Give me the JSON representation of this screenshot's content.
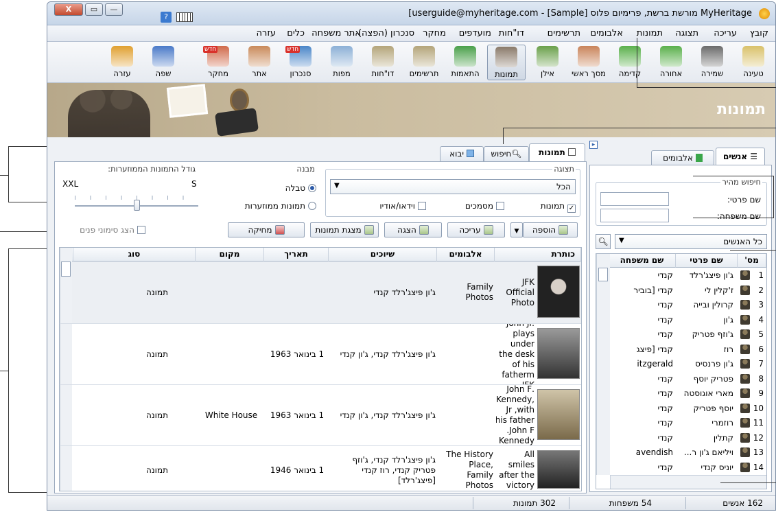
{
  "window": {
    "title": "MyHeritage מורשת ברשת, פרימיום פלוס [Sample] - userguide@myheritage.com]",
    "controls": {
      "close": "X",
      "restore": "▭",
      "minimize": "—"
    }
  },
  "menu": [
    "קובץ",
    "עריכה",
    "תצוגה",
    "תמונות",
    "אלבומים",
    "תרשימים",
    "דו\"חות",
    "מועדפים",
    "מחקר",
    "סנכרון (הפצה)",
    "אתר משפחה",
    "כלים",
    "עזרה"
  ],
  "toolbar": {
    "buttons": [
      {
        "label": "טעינה",
        "icon": "open-folder-icon"
      },
      {
        "label": "שמירה",
        "icon": "save-icon"
      },
      {
        "label": "אחורה",
        "icon": "back-arrow-icon"
      },
      {
        "label": "קדימה",
        "icon": "forward-arrow-icon"
      },
      {
        "label": "מסך ראשי",
        "icon": "home-icon"
      },
      {
        "label": "אילן",
        "icon": "tree-icon"
      },
      {
        "label": "תמונות",
        "icon": "photos-icon"
      },
      {
        "label": "התאמות",
        "icon": "matches-icon"
      },
      {
        "label": "תרשימים",
        "icon": "charts-icon"
      },
      {
        "label": "דו\"חות",
        "icon": "reports-icon"
      },
      {
        "label": "מפות",
        "icon": "maps-icon"
      },
      {
        "label": "סנכרון",
        "icon": "sync-icon",
        "badge": "חדש"
      },
      {
        "label": "אתר",
        "icon": "family-site-icon"
      },
      {
        "label": "מחקר",
        "icon": "research-icon",
        "badge": "חדש"
      },
      {
        "label": "שפה",
        "icon": "language-flag-icon"
      },
      {
        "label": "עזרה",
        "icon": "help-icon"
      }
    ]
  },
  "banner": {
    "title": "תמונות"
  },
  "left": {
    "tabs": [
      "אנשים",
      "אלבומים"
    ],
    "quick_search": {
      "legend": "חיפוש מהיר",
      "first_name": "שם פרטי:",
      "last_name": "שם משפחה:"
    },
    "filter": "כל האנשים",
    "columns": [
      "מס'",
      "שם פרטי",
      "שם משפחה"
    ],
    "people": [
      {
        "n": "1",
        "first": "ג'ון פיצג'רלד",
        "last": "קנדי"
      },
      {
        "n": "2",
        "first": "ז'קלין לי",
        "last": "קנדי [בוביר"
      },
      {
        "n": "3",
        "first": "קרולין ובייה",
        "last": "קנדי"
      },
      {
        "n": "4",
        "first": "ג'ון",
        "last": "קנדי"
      },
      {
        "n": "5",
        "first": "ג'וזף פטריק",
        "last": "קנדי"
      },
      {
        "n": "6",
        "first": "רוז",
        "last": "קנדי [פיצג"
      },
      {
        "n": "7",
        "first": "ג'ון פרנסיס",
        "last": "itzgerald"
      },
      {
        "n": "8",
        "first": "פטריק יוסף",
        "last": "קנדי"
      },
      {
        "n": "9",
        "first": "מארי אוגוסטה",
        "last": "קנדי"
      },
      {
        "n": "10",
        "first": "יוסף פטריק",
        "last": "קנדי"
      },
      {
        "n": "11",
        "first": "רוזמרי",
        "last": "קנדי"
      },
      {
        "n": "12",
        "first": "קתלין",
        "last": "קנדי"
      },
      {
        "n": "13",
        "first": "ויליאם ג'ון ר...",
        "last": "avendish"
      },
      {
        "n": "14",
        "first": "יוניס קנדי",
        "last": "קנדי"
      }
    ]
  },
  "right": {
    "tabs": [
      "תמונות",
      "חיפוש",
      "יבוא"
    ],
    "display": {
      "legend": "תצוגה",
      "select": "הכל",
      "photos": "תמונות",
      "documents": "מסמכים",
      "video": "וידאו/אודיו"
    },
    "structure": {
      "legend": "מבנה",
      "table": "טבלה",
      "thumbs": "תמונות ממוזערות"
    },
    "thumb_size": {
      "legend": "גודל התמונות הממוזערות:",
      "min": "S",
      "max": "XXL",
      "level": 0.5
    },
    "actions": {
      "add": "הוספה",
      "edit": "עריכה",
      "show": "הצגה",
      "slideshow": "מצגת תמונות",
      "delete": "מחיקה",
      "face_tags": "הצג סימוני פנים"
    },
    "columns": [
      "כותרת",
      "אלבומים",
      "שיוכים",
      "תאריך",
      "מקום",
      "סוג"
    ],
    "rows": [
      {
        "title": "JFK Official Photo",
        "albums": "Family Photos",
        "tags": "ג'ון פיצג'רלד קנדי",
        "date": "",
        "place": "",
        "type": "תמונה"
      },
      {
        "title": "John Jr. plays under the desk of his fatherm .JFK",
        "albums": "",
        "tags": "ג'ון פיצג'רלד קנדי, ג'ון קנדי",
        "date": "1 בינואר 1963",
        "place": "",
        "type": "תמונה"
      },
      {
        "title": ".John F .Kennedy, Jr ,with his father .John F Kennedy",
        "albums": "",
        "tags": "ג'ון פיצג'רלד קנדי, ג'ון קנדי",
        "date": "1 בינואר 1963",
        "place": "White House",
        "type": "תמונה"
      },
      {
        "title": "All smiles after the victory",
        "albums": "The History Place, Family Photos",
        "tags": "ג'ון פיצג'רלד קנדי, ג'וזף פטריק קנדי, רוז קנדי [פיצג'רלד]",
        "date": "1 בינואר 1946",
        "place": "",
        "type": "תמונה"
      }
    ]
  },
  "status": {
    "people": "162 אנשים",
    "families": "54 משפחות",
    "photos": "302 תמונות"
  }
}
